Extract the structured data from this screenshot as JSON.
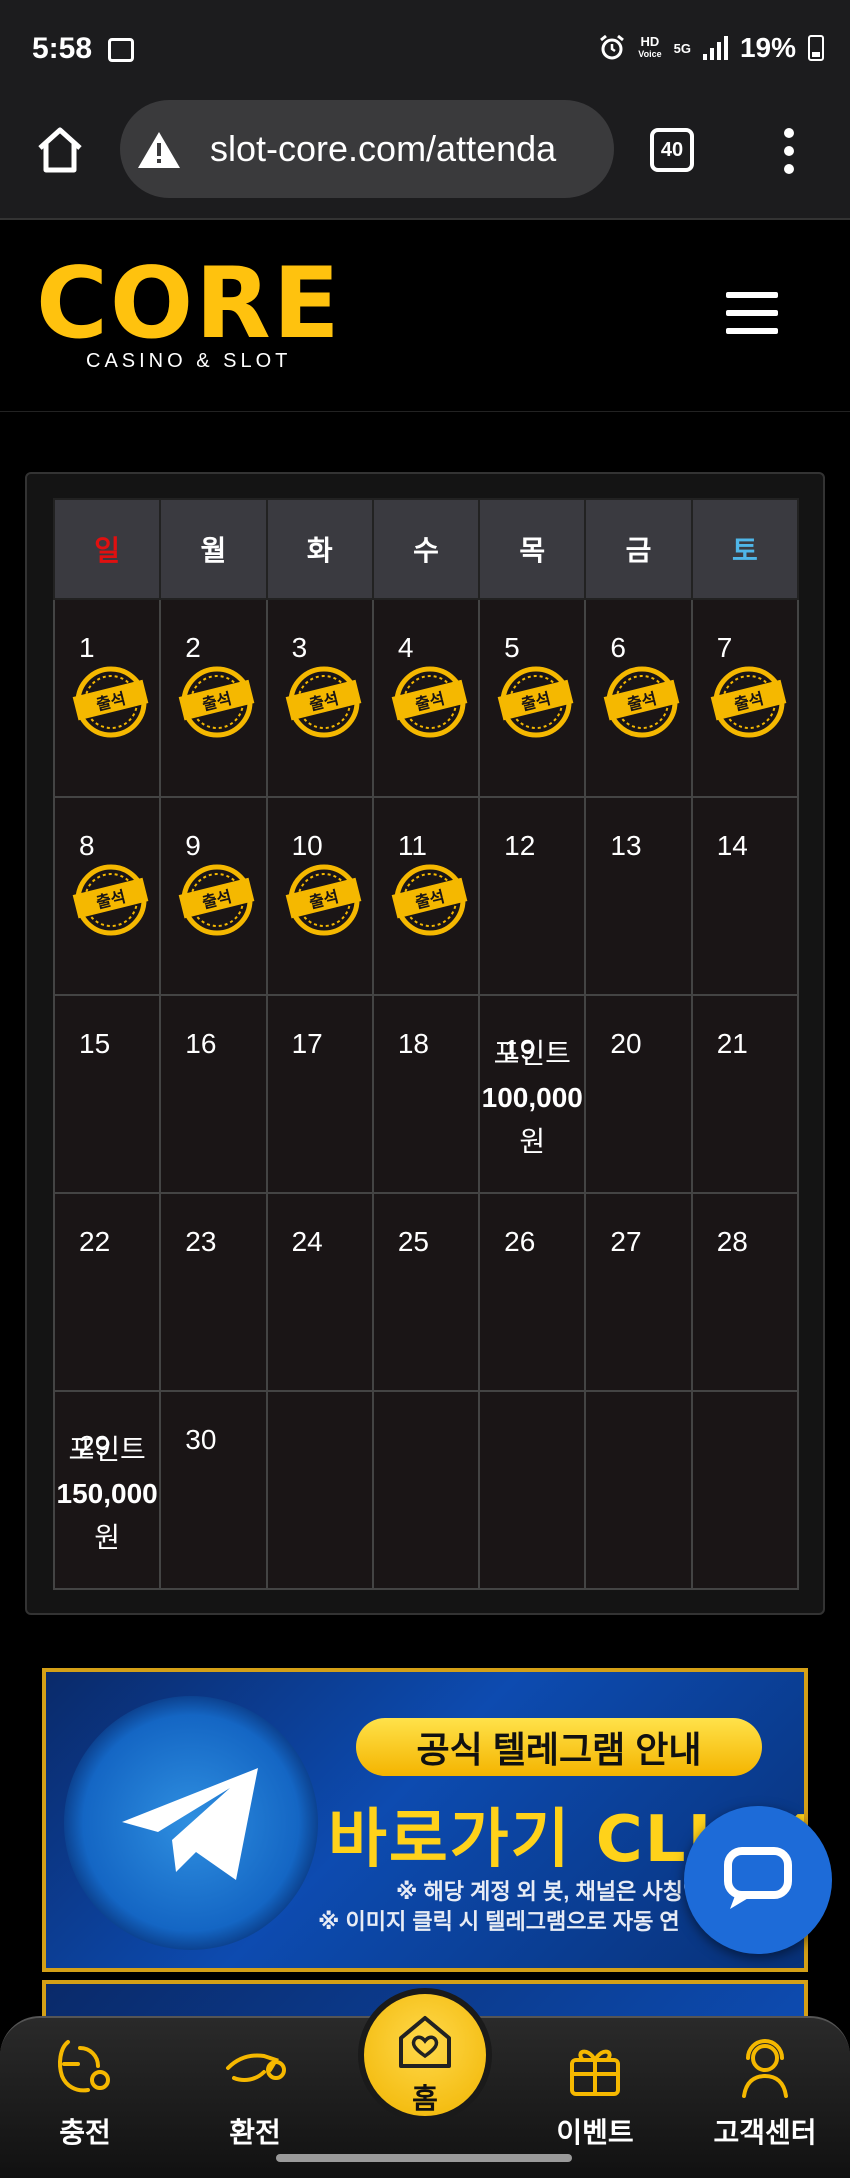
{
  "status_bar": {
    "time": "5:58",
    "hd_label": "HD",
    "voice_label": "Voice",
    "network": "5G",
    "battery": "19%"
  },
  "browser": {
    "url": "slot-core.com/attenda",
    "tab_count": "40"
  },
  "site": {
    "logo_word": "CORE",
    "logo_sub": "CASINO & SLOT"
  },
  "calendar": {
    "weekdays": [
      "일",
      "월",
      "화",
      "수",
      "목",
      "금",
      "토"
    ],
    "weeks": [
      [
        {
          "day": "1",
          "stamp": true
        },
        {
          "day": "2",
          "stamp": true
        },
        {
          "day": "3",
          "stamp": true
        },
        {
          "day": "4",
          "stamp": true
        },
        {
          "day": "5",
          "stamp": true
        },
        {
          "day": "6",
          "stamp": true
        },
        {
          "day": "7",
          "stamp": true
        }
      ],
      [
        {
          "day": "8",
          "stamp": true
        },
        {
          "day": "9",
          "stamp": true
        },
        {
          "day": "10",
          "stamp": true
        },
        {
          "day": "11",
          "stamp": true
        },
        {
          "day": "12"
        },
        {
          "day": "13"
        },
        {
          "day": "14"
        }
      ],
      [
        {
          "day": "15"
        },
        {
          "day": "16"
        },
        {
          "day": "17"
        },
        {
          "day": "18"
        },
        {
          "day": "19",
          "point_label": "포인트",
          "point_amount": "100,000",
          "point_unit": "원"
        },
        {
          "day": "20"
        },
        {
          "day": "21"
        }
      ],
      [
        {
          "day": "22"
        },
        {
          "day": "23"
        },
        {
          "day": "24"
        },
        {
          "day": "25"
        },
        {
          "day": "26"
        },
        {
          "day": "27"
        },
        {
          "day": "28"
        }
      ],
      [
        {
          "day": "29",
          "point_label": "포인트",
          "point_amount": "150,000",
          "point_unit": "원"
        },
        {
          "day": "30"
        },
        {
          "day": ""
        },
        {
          "day": ""
        },
        {
          "day": ""
        },
        {
          "day": ""
        },
        {
          "day": ""
        }
      ]
    ],
    "stamp_text": "출석"
  },
  "banner": {
    "title": "공식 텔레그램 안내",
    "cta": "바로가기 CLICK",
    "note1": "※ 해당 계정 외 봇, 채널은 사칭입",
    "note2": "※ 이미지 클릭 시 텔레그램으로 자동 연"
  },
  "bottom_nav": {
    "deposit": "충전",
    "withdraw": "환전",
    "home": "홈",
    "event": "이벤트",
    "support": "고객센터"
  },
  "colors": {
    "accent_gold": "#ffc20e",
    "sunday_red": "#e01010",
    "saturday_blue": "#4fb6e8",
    "chat_blue": "#1d6bd8"
  }
}
